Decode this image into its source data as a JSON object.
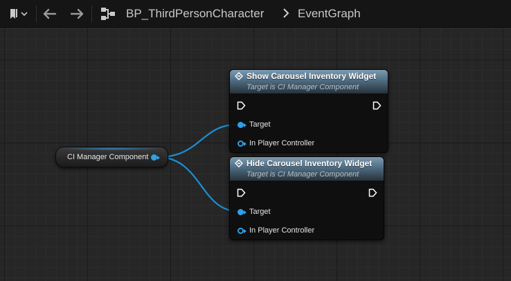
{
  "breadcrumb": {
    "blueprint": "BP_ThirdPersonCharacter",
    "separator": ">",
    "graph": "EventGraph"
  },
  "toolbar": {
    "icons": [
      "bookmark-icon",
      "chevron-down-icon",
      "back-arrow-icon",
      "forward-arrow-icon",
      "graph-hierarchy-icon"
    ]
  },
  "variable_node": {
    "label": "CI Manager Component",
    "pin_color": "#2ea0e8"
  },
  "nodes": [
    {
      "title": "Show Carousel Inventory Widget",
      "subtitle": "Target is CI Manager Component",
      "pins": [
        {
          "label": "Target",
          "type": "object"
        },
        {
          "label": "In Player Controller",
          "type": "object-hollow"
        }
      ]
    },
    {
      "title": "Hide Carousel Inventory Widget",
      "subtitle": "Target is CI Manager Component",
      "pins": [
        {
          "label": "Target",
          "type": "object"
        },
        {
          "label": "In Player Controller",
          "type": "object-hollow"
        }
      ]
    }
  ],
  "colors": {
    "header_top": "#7c9bb1",
    "header_bottom": "#26323b",
    "object_pin": "#2ea0e8",
    "canvas": "#262626",
    "wire": "#1b8fd6"
  }
}
